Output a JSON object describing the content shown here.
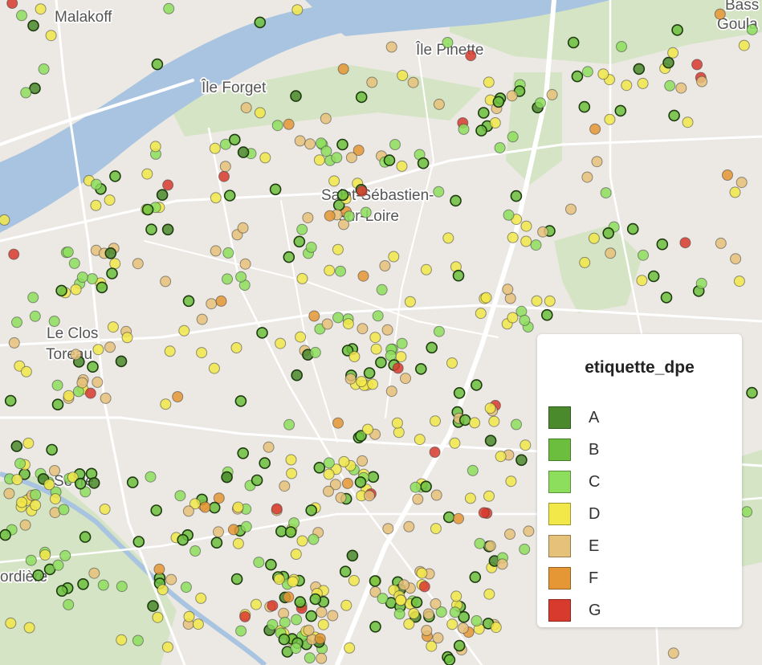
{
  "map": {
    "place_labels": [
      {
        "text": "Malakoff"
      },
      {
        "text": "Île Pinette"
      },
      {
        "text": "Île Forget"
      },
      {
        "text": "Saint-Sébastien-"
      },
      {
        "text": "sur-Loire"
      },
      {
        "text": "Le Clos"
      },
      {
        "text": "Toreau"
      },
      {
        "text": "Sèvre"
      },
      {
        "text": "ordière"
      },
      {
        "text": "Bass"
      },
      {
        "text": "Goula"
      }
    ]
  },
  "legend": {
    "title": "etiquette_dpe",
    "items": [
      {
        "label": "A",
        "color": "#4a8a2c"
      },
      {
        "label": "B",
        "color": "#6cbf3e"
      },
      {
        "label": "C",
        "color": "#8ede5e"
      },
      {
        "label": "D",
        "color": "#f2e84a"
      },
      {
        "label": "E",
        "color": "#e6c17a"
      },
      {
        "label": "F",
        "color": "#e59635"
      },
      {
        "label": "G",
        "color": "#d83a2e"
      }
    ]
  }
}
